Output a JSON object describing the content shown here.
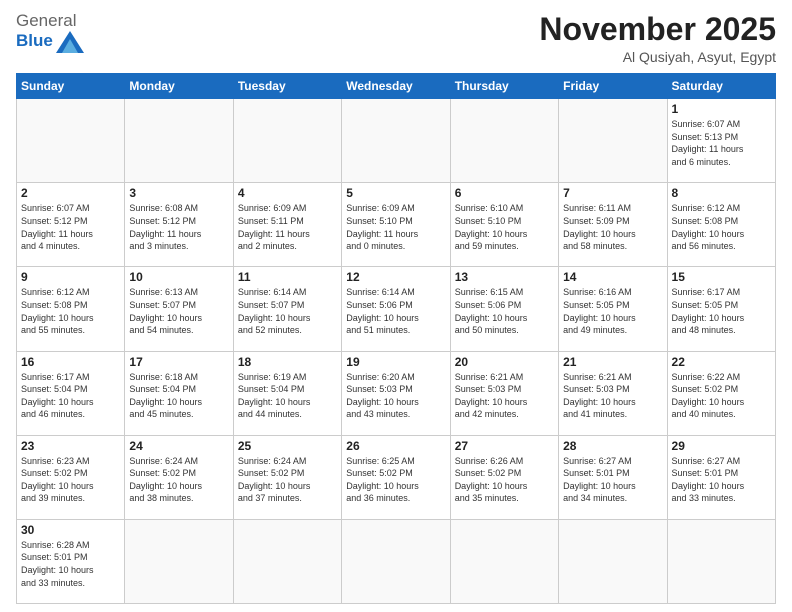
{
  "header": {
    "logo_general": "General",
    "logo_blue": "Blue",
    "month_title": "November 2025",
    "location": "Al Qusiyah, Asyut, Egypt"
  },
  "days_of_week": [
    "Sunday",
    "Monday",
    "Tuesday",
    "Wednesday",
    "Thursday",
    "Friday",
    "Saturday"
  ],
  "weeks": [
    [
      {
        "day": "",
        "info": ""
      },
      {
        "day": "",
        "info": ""
      },
      {
        "day": "",
        "info": ""
      },
      {
        "day": "",
        "info": ""
      },
      {
        "day": "",
        "info": ""
      },
      {
        "day": "",
        "info": ""
      },
      {
        "day": "1",
        "info": "Sunrise: 6:07 AM\nSunset: 5:13 PM\nDaylight: 11 hours\nand 6 minutes."
      }
    ],
    [
      {
        "day": "2",
        "info": "Sunrise: 6:07 AM\nSunset: 5:12 PM\nDaylight: 11 hours\nand 4 minutes."
      },
      {
        "day": "3",
        "info": "Sunrise: 6:08 AM\nSunset: 5:12 PM\nDaylight: 11 hours\nand 3 minutes."
      },
      {
        "day": "4",
        "info": "Sunrise: 6:09 AM\nSunset: 5:11 PM\nDaylight: 11 hours\nand 2 minutes."
      },
      {
        "day": "5",
        "info": "Sunrise: 6:09 AM\nSunset: 5:10 PM\nDaylight: 11 hours\nand 0 minutes."
      },
      {
        "day": "6",
        "info": "Sunrise: 6:10 AM\nSunset: 5:10 PM\nDaylight: 10 hours\nand 59 minutes."
      },
      {
        "day": "7",
        "info": "Sunrise: 6:11 AM\nSunset: 5:09 PM\nDaylight: 10 hours\nand 58 minutes."
      },
      {
        "day": "8",
        "info": "Sunrise: 6:12 AM\nSunset: 5:08 PM\nDaylight: 10 hours\nand 56 minutes."
      }
    ],
    [
      {
        "day": "9",
        "info": "Sunrise: 6:12 AM\nSunset: 5:08 PM\nDaylight: 10 hours\nand 55 minutes."
      },
      {
        "day": "10",
        "info": "Sunrise: 6:13 AM\nSunset: 5:07 PM\nDaylight: 10 hours\nand 54 minutes."
      },
      {
        "day": "11",
        "info": "Sunrise: 6:14 AM\nSunset: 5:07 PM\nDaylight: 10 hours\nand 52 minutes."
      },
      {
        "day": "12",
        "info": "Sunrise: 6:14 AM\nSunset: 5:06 PM\nDaylight: 10 hours\nand 51 minutes."
      },
      {
        "day": "13",
        "info": "Sunrise: 6:15 AM\nSunset: 5:06 PM\nDaylight: 10 hours\nand 50 minutes."
      },
      {
        "day": "14",
        "info": "Sunrise: 6:16 AM\nSunset: 5:05 PM\nDaylight: 10 hours\nand 49 minutes."
      },
      {
        "day": "15",
        "info": "Sunrise: 6:17 AM\nSunset: 5:05 PM\nDaylight: 10 hours\nand 48 minutes."
      }
    ],
    [
      {
        "day": "16",
        "info": "Sunrise: 6:17 AM\nSunset: 5:04 PM\nDaylight: 10 hours\nand 46 minutes."
      },
      {
        "day": "17",
        "info": "Sunrise: 6:18 AM\nSunset: 5:04 PM\nDaylight: 10 hours\nand 45 minutes."
      },
      {
        "day": "18",
        "info": "Sunrise: 6:19 AM\nSunset: 5:04 PM\nDaylight: 10 hours\nand 44 minutes."
      },
      {
        "day": "19",
        "info": "Sunrise: 6:20 AM\nSunset: 5:03 PM\nDaylight: 10 hours\nand 43 minutes."
      },
      {
        "day": "20",
        "info": "Sunrise: 6:21 AM\nSunset: 5:03 PM\nDaylight: 10 hours\nand 42 minutes."
      },
      {
        "day": "21",
        "info": "Sunrise: 6:21 AM\nSunset: 5:03 PM\nDaylight: 10 hours\nand 41 minutes."
      },
      {
        "day": "22",
        "info": "Sunrise: 6:22 AM\nSunset: 5:02 PM\nDaylight: 10 hours\nand 40 minutes."
      }
    ],
    [
      {
        "day": "23",
        "info": "Sunrise: 6:23 AM\nSunset: 5:02 PM\nDaylight: 10 hours\nand 39 minutes."
      },
      {
        "day": "24",
        "info": "Sunrise: 6:24 AM\nSunset: 5:02 PM\nDaylight: 10 hours\nand 38 minutes."
      },
      {
        "day": "25",
        "info": "Sunrise: 6:24 AM\nSunset: 5:02 PM\nDaylight: 10 hours\nand 37 minutes."
      },
      {
        "day": "26",
        "info": "Sunrise: 6:25 AM\nSunset: 5:02 PM\nDaylight: 10 hours\nand 36 minutes."
      },
      {
        "day": "27",
        "info": "Sunrise: 6:26 AM\nSunset: 5:02 PM\nDaylight: 10 hours\nand 35 minutes."
      },
      {
        "day": "28",
        "info": "Sunrise: 6:27 AM\nSunset: 5:01 PM\nDaylight: 10 hours\nand 34 minutes."
      },
      {
        "day": "29",
        "info": "Sunrise: 6:27 AM\nSunset: 5:01 PM\nDaylight: 10 hours\nand 33 minutes."
      }
    ],
    [
      {
        "day": "30",
        "info": "Sunrise: 6:28 AM\nSunset: 5:01 PM\nDaylight: 10 hours\nand 33 minutes."
      },
      {
        "day": "",
        "info": ""
      },
      {
        "day": "",
        "info": ""
      },
      {
        "day": "",
        "info": ""
      },
      {
        "day": "",
        "info": ""
      },
      {
        "day": "",
        "info": ""
      },
      {
        "day": "",
        "info": ""
      }
    ]
  ]
}
